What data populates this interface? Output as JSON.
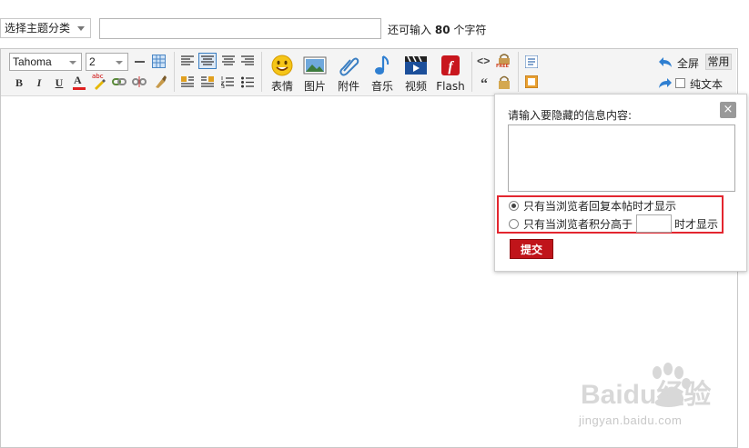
{
  "topbar": {
    "category_select": "选择主题分类",
    "remaining_prefix": "还可输入",
    "remaining_count": "80",
    "remaining_suffix": "个字符"
  },
  "toolbar": {
    "font_family": "Tahoma",
    "font_size": "2",
    "bold": "B",
    "italic": "I",
    "underline": "U",
    "font_color": "A",
    "highlight": "abc",
    "labels": {
      "emoticon": "表情",
      "image": "图片",
      "attachment": "附件",
      "music": "音乐",
      "video": "视频",
      "flash": "Flash"
    },
    "code": "<>",
    "quote": "“",
    "free_badge": "FREE",
    "fullscreen": "全屏",
    "common": "常用",
    "plain_text": "纯文本"
  },
  "hide_popup": {
    "close": "×",
    "prompt": "请输入要隐藏的信息内容:",
    "option_reply": "只有当浏览者回复本帖时才显示",
    "option_score_prefix": "只有当浏览者积分高于",
    "option_score_suffix": "时才显示",
    "submit": "提交",
    "selected_option": "reply"
  },
  "watermark": {
    "brand": "Baidu经验",
    "url": "jingyan.baidu.com"
  },
  "colors": {
    "highlight_border": "#e3262f",
    "submit_bg": "#c0141a",
    "icon_blue": "#2f7fd1"
  }
}
